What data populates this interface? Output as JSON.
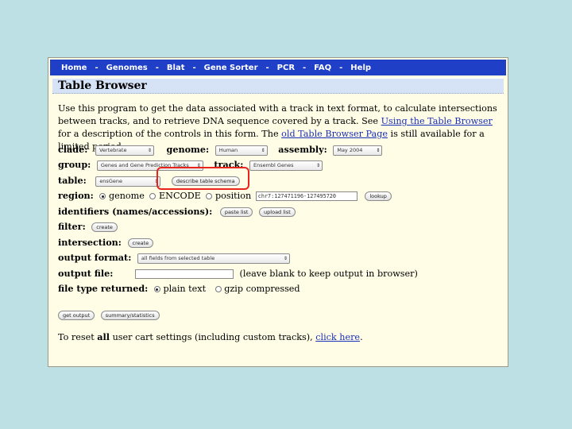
{
  "nav": {
    "items": [
      "Home",
      "Genomes",
      "Blat",
      "Gene Sorter",
      "PCR",
      "FAQ",
      "Help"
    ],
    "separator": "-"
  },
  "page_title": "Table Browser",
  "intro": {
    "text1": "Use this program to get the data associated with a track in text format, to calculate intersections between tracks, and to retrieve DNA sequence covered by a track. See ",
    "link1": "Using the Table Browser",
    "text2": " for a description of the controls in this form. The ",
    "link2": "old Table Browser Page",
    "text3": " is still available for a limited period."
  },
  "form": {
    "clade_label": "clade:",
    "clade_value": "Vertebrate",
    "genome_label": "genome:",
    "genome_value": "Human",
    "assembly_label": "assembly:",
    "assembly_value": "May 2004",
    "group_label": "group:",
    "group_value": "Genes and Gene Prediction Tracks",
    "track_label": "track:",
    "track_value": "Ensembl Genes",
    "table_label": "table:",
    "table_value": "ensGene",
    "describe_button": "describe table schema",
    "region_label": "region:",
    "region_genome": "genome",
    "region_encode": "ENCODE",
    "region_position": "position",
    "position_value": "chr7:127471196-127495720",
    "lookup_button": "lookup",
    "identifiers_label": "identifiers (names/accessions):",
    "paste_list_button": "paste list",
    "upload_list_button": "upload list",
    "filter_label": "filter:",
    "filter_button": "create",
    "intersection_label": "intersection:",
    "intersection_button": "create",
    "output_format_label": "output format:",
    "output_format_value": "all fields from selected table",
    "output_file_label": "output file:",
    "output_file_value": "",
    "output_file_hint": "(leave blank to keep output in browser)",
    "file_type_label": "file type returned:",
    "file_type_plain": "plain text",
    "file_type_gzip": "gzip compressed",
    "get_output_button": "get output",
    "summary_button": "summary/statistics"
  },
  "reset": {
    "text1": "To reset ",
    "bold": "all",
    "text2": " user cart settings (including custom tracks), ",
    "link": "click here",
    "text3": "."
  },
  "colors": {
    "nav_bg": "#1f3fc6",
    "page_bg": "#fffde6",
    "outer_bg": "#bde0e4",
    "title_bg": "#d6e2f5",
    "link": "#1a2fb8",
    "highlight": "#e8241c"
  }
}
